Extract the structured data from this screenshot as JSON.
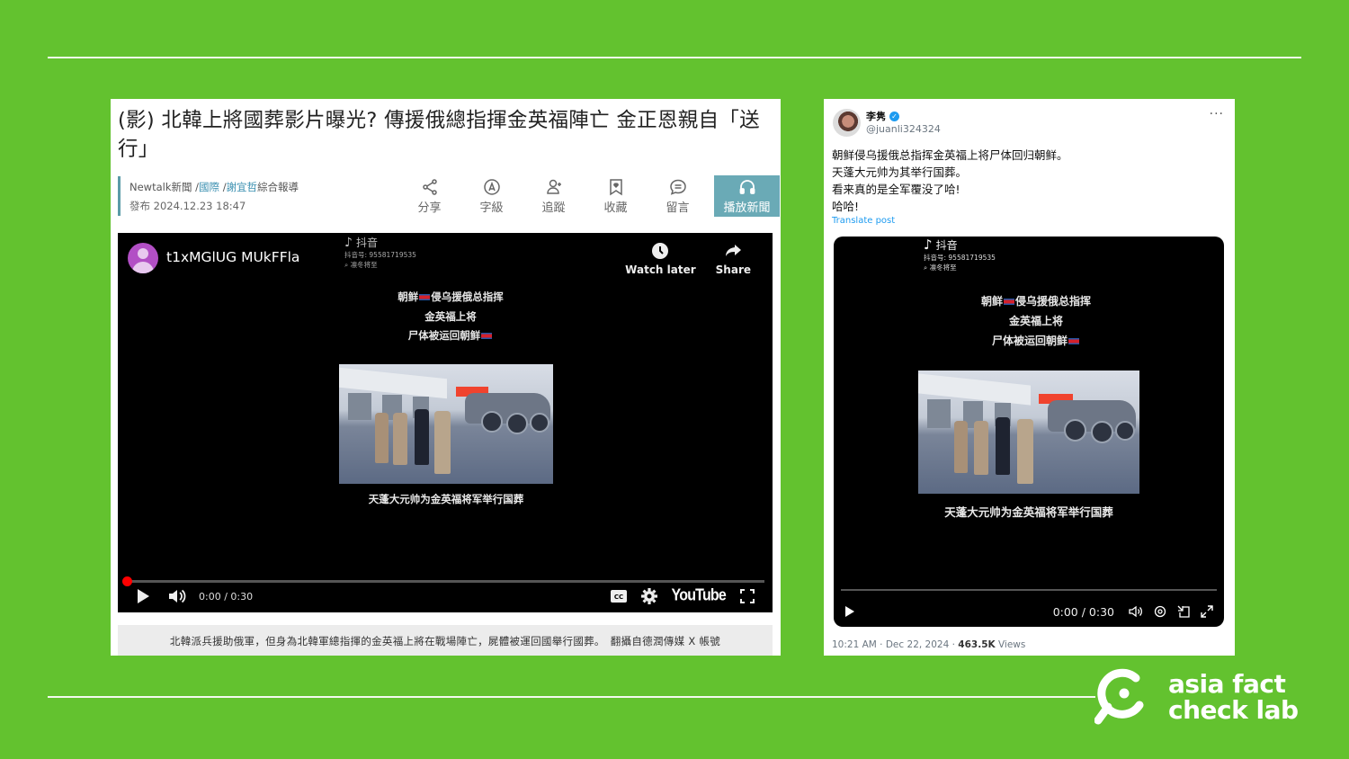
{
  "background_color": "#63c22f",
  "left_article": {
    "title": "(影) 北韓上將國葬影片曝光? 傳援俄總指揮金英福陣亡 金正恩親自「送行」",
    "meta": {
      "source": "Newtalk新聞",
      "category": "國際",
      "author": "謝宜哲",
      "report_type": "綜合報導",
      "published_label": "發布",
      "published_at": "2024.12.23 18:47"
    },
    "toolbar": [
      {
        "icon": "share-icon",
        "label": "分享"
      },
      {
        "icon": "font-size-icon",
        "label": "字級"
      },
      {
        "icon": "follow-icon",
        "label": "追蹤"
      },
      {
        "icon": "bookmark-icon",
        "label": "收藏"
      },
      {
        "icon": "comment-icon",
        "label": "留言"
      },
      {
        "icon": "headphones-icon",
        "label": "播放新聞"
      }
    ],
    "accent_color": "#6aaab6",
    "youtube": {
      "channel_name": "t1xMGlUG MUkFFla",
      "watch_later_label": "Watch later",
      "share_label": "Share",
      "time": "0:00 / 0:30",
      "progress_percent": 0,
      "logo_text": "YouTube"
    },
    "caption": "北韓派兵援助俄軍，但身為北韓軍總指揮的金英福上將在戰場陣亡，屍體被運回國舉行國葬。　翻攝自德潤傳媒 X 帳號"
  },
  "video_overlay": {
    "douyin_label": "抖音",
    "douyin_id": "抖音号: 95581719535",
    "douyin_search": "凛冬将至",
    "caption_line1_a": "朝鲜",
    "caption_line1_b": "侵乌援俄总指挥",
    "caption_line2": "金英福上将",
    "caption_line3": "尸体被运回朝鲜",
    "subtitle": "天蓬大元帅为金英福将军举行国葬"
  },
  "right_post": {
    "display_name": "李隽",
    "verified": true,
    "handle": "@juanli324324",
    "text_lines": [
      "朝鲜侵乌援俄总指挥金英福上将尸体回归朝鲜。",
      "天蓬大元帅为其举行国葬。",
      "看来真的是全军覆没了哈!",
      "哈哈!"
    ],
    "translate_label": "Translate post",
    "video_time": "0:00 / 0:30",
    "timestamp": "10:21 AM · Dec 22, 2024 · ",
    "views_count": "463.5K",
    "views_label": " Views"
  },
  "logo": {
    "line1": "asia fact",
    "line2": "check lab"
  }
}
